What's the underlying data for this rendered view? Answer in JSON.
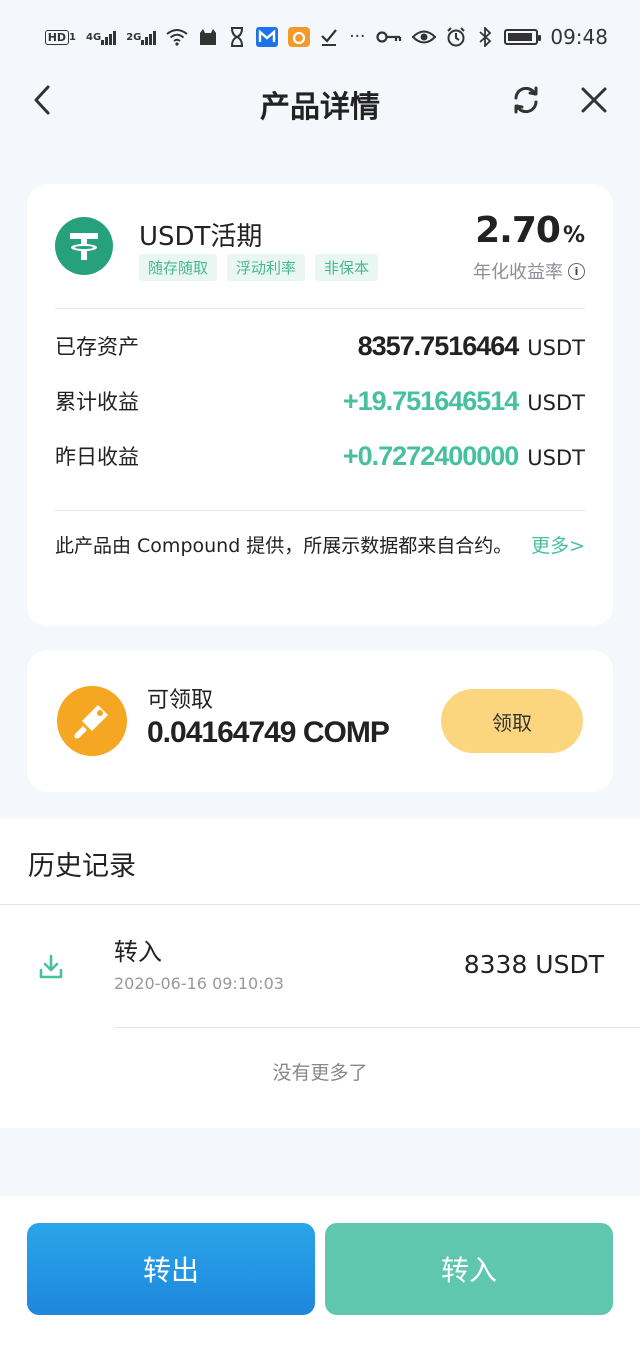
{
  "status_bar": {
    "time": "09:48",
    "hd_label": "HD",
    "sim1": "1",
    "net1": "4G",
    "net2": "2G",
    "more": "···",
    "icons": [
      "hd-icon",
      "signal-4g-icon",
      "signal-2g-icon",
      "wifi-icon",
      "cat-app-icon",
      "hourglass-icon",
      "gmail-icon",
      "uc-browser-icon",
      "check-icon",
      "more-icon",
      "key-icon",
      "eye-icon",
      "alarm-icon",
      "bluetooth-icon",
      "battery-icon"
    ]
  },
  "header": {
    "title": "产品详情",
    "icons": [
      "back-icon",
      "refresh-icon",
      "close-icon"
    ]
  },
  "product": {
    "name": "USDT活期",
    "tags": [
      "随存随取",
      "浮动利率",
      "非保本"
    ],
    "rate_value": "2.70",
    "rate_unit": "%",
    "rate_label": "年化收益率",
    "info_glyph": "i",
    "stats": [
      {
        "label": "已存资产",
        "value": "8357.7516464",
        "unit": "USDT",
        "highlight": false
      },
      {
        "label": "累计收益",
        "value": "+19.751646514",
        "unit": "USDT",
        "highlight": true
      },
      {
        "label": "昨日收益",
        "value": "+0.7272400000",
        "unit": "USDT",
        "highlight": true
      }
    ],
    "note": "此产品由 Compound 提供，所展示数据都来自合约。",
    "more_link": "更多>"
  },
  "claim": {
    "label": "可领取",
    "value": "0.04164749 COMP",
    "button": "领取"
  },
  "history": {
    "title": "历史记录",
    "records": [
      {
        "type": "转入",
        "time": "2020-06-16 09:10:03",
        "amount": "8338 USDT",
        "icon": "download-icon"
      }
    ],
    "end_text": "没有更多了"
  },
  "actions": {
    "transfer_out": "转出",
    "transfer_in": "转入"
  },
  "colors": {
    "accent_green": "#47c0a0",
    "tether_green": "#26a17b",
    "comp_orange": "#f5a623",
    "claim_button": "#fcd57f",
    "transfer_out_blue": "#1e87dc",
    "transfer_in_green": "#5ec7ae"
  }
}
